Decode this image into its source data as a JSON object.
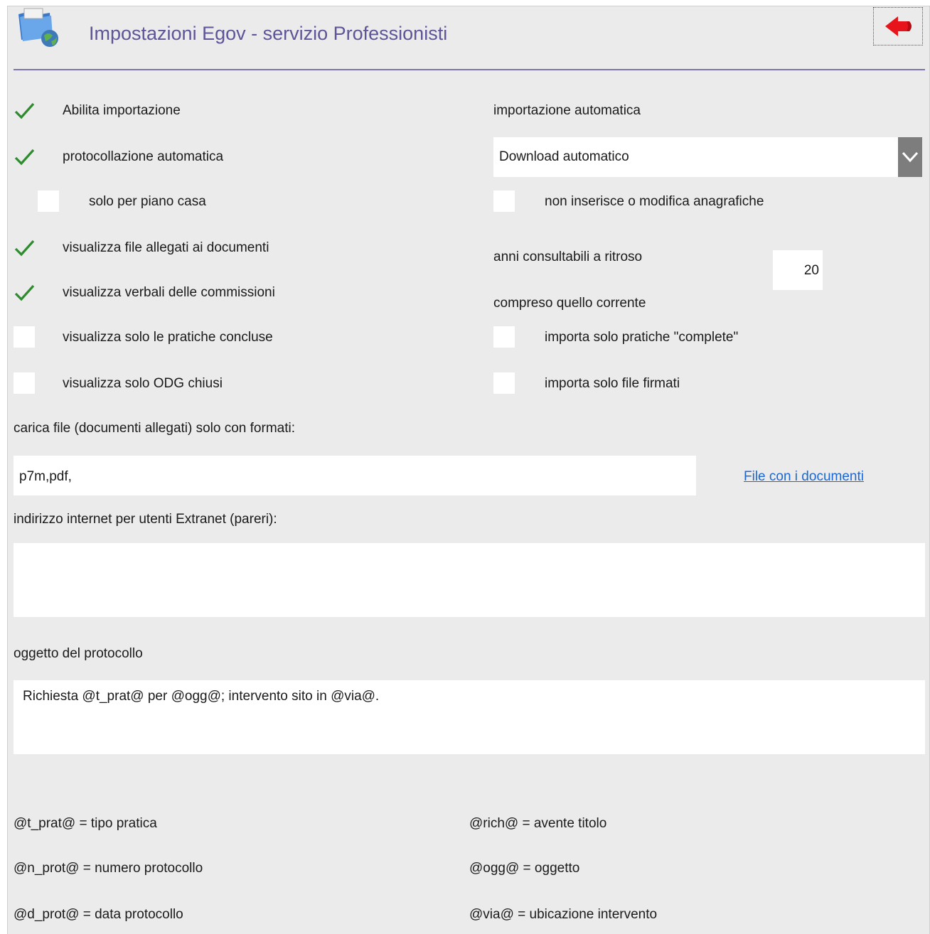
{
  "header": {
    "title": "Impostazioni Egov - servizio Professionisti",
    "app_icon": "folder-globe-icon",
    "back_icon": "red-back-arrow-icon"
  },
  "left_options": [
    {
      "label": "Abilita importazione",
      "checked": true
    },
    {
      "label": "protocollazione automatica",
      "checked": true
    },
    {
      "label": "solo per piano casa",
      "checked": false
    },
    {
      "label": "visualizza file allegati ai documenti",
      "checked": true
    },
    {
      "label": "visualizza verbali delle commissioni",
      "checked": true
    },
    {
      "label": "visualizza solo le pratiche concluse",
      "checked": false
    },
    {
      "label": "visualizza solo ODG chiusi",
      "checked": false
    }
  ],
  "import": {
    "label": "importazione automatica",
    "selected": "Download automatico",
    "no_anagrafiche_label": "non inserisce o modifica anagrafiche",
    "no_anagrafiche_checked": false,
    "years_label_1": "anni consultabili a ritroso",
    "years_label_2": "compreso quello corrente",
    "years_value": "20",
    "only_complete_label": "importa solo pratiche \"complete\"",
    "only_complete_checked": false,
    "only_signed_label": "importa solo file firmati",
    "only_signed_checked": false
  },
  "formats": {
    "label": "carica file (documenti allegati) solo con formati:",
    "value": "p7m,pdf,",
    "link": "File con i documenti"
  },
  "extranet": {
    "label": "indirizzo internet per utenti Extranet (pareri):",
    "value": ""
  },
  "protocol_subject": {
    "label": "oggetto del protocollo",
    "value": "Richiesta @t_prat@ per @ogg@; intervento sito in @via@."
  },
  "legend": {
    "left": [
      "@t_prat@ = tipo pratica",
      "@n_prot@ = numero protocollo",
      "@d_prot@ = data protocollo"
    ],
    "right": [
      "@rich@ = avente titolo",
      "@ogg@ = oggetto",
      "@via@ = ubicazione intervento"
    ]
  },
  "colors": {
    "title": "#5d5597",
    "check": "#2e8b2e",
    "link": "#1c67d2",
    "panel": "#ebebeb"
  }
}
